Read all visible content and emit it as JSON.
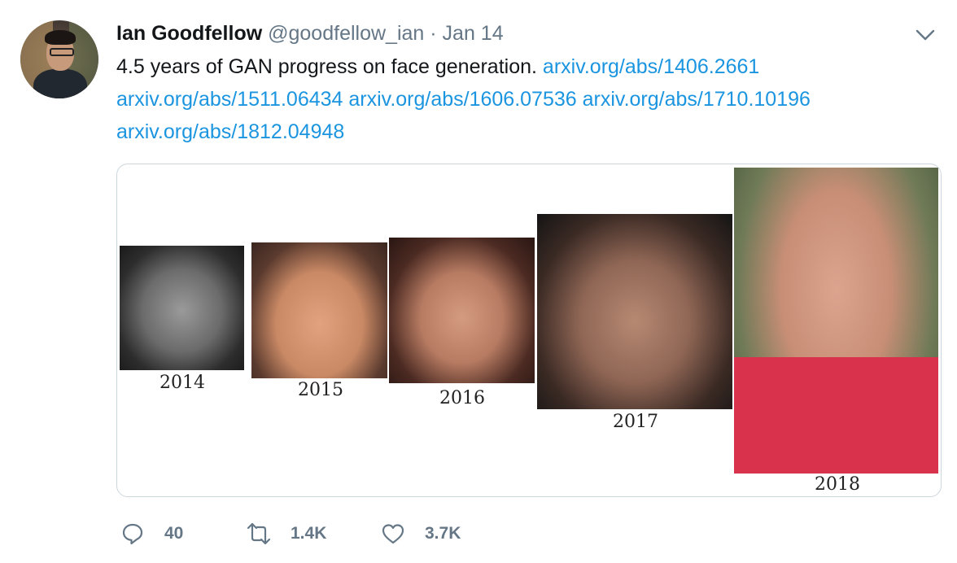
{
  "tweet": {
    "author_name": "Ian Goodfellow",
    "handle": "@goodfellow_ian",
    "separator": "·",
    "date": "Jan 14",
    "text": "4.5 years of GAN progress on face generation.",
    "links": [
      "arxiv.org/abs/1406.2661",
      "arxiv.org/abs/1511.06434",
      "arxiv.org/abs/1606.07536",
      "arxiv.org/abs/1710.10196",
      "arxiv.org/abs/1812.04948"
    ]
  },
  "media": {
    "years": [
      "2014",
      "2015",
      "2016",
      "2017",
      "2018"
    ]
  },
  "actions": {
    "replies": "40",
    "retweets": "1.4K",
    "likes": "3.7K"
  },
  "icons": {
    "menu": "chevron-down-icon",
    "reply": "reply-icon",
    "retweet": "retweet-icon",
    "like": "heart-icon"
  },
  "colors": {
    "link": "#1b95e0",
    "muted": "#657786",
    "text": "#14171a"
  }
}
